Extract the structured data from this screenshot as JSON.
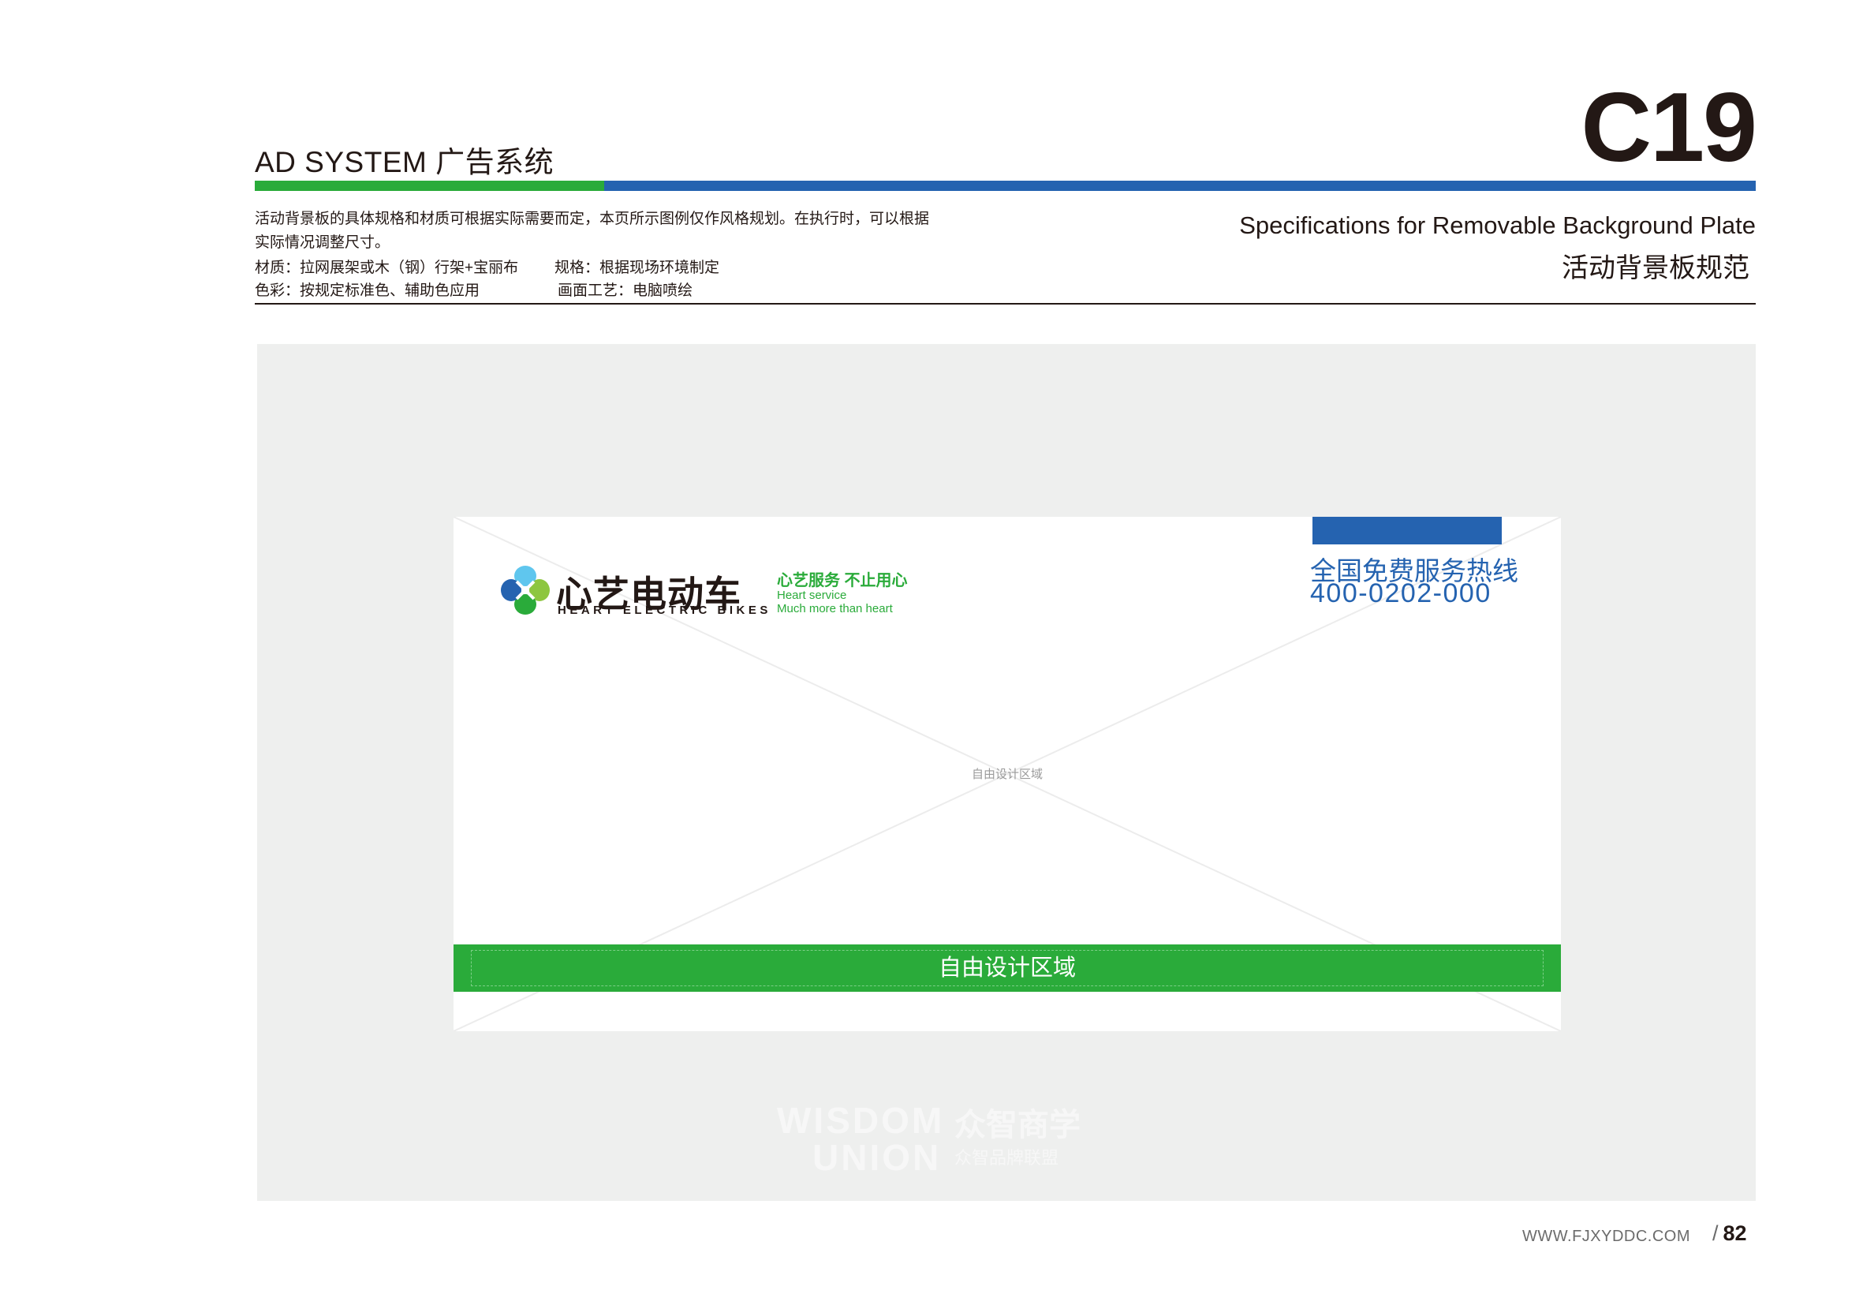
{
  "header": {
    "section_title": "AD SYSTEM 广告系统",
    "page_code": "C19",
    "description": [
      "活动背景板的具体规格和材质可根据实际需要而定，本页所示图例仅作风格规划。在执行时，可以根据",
      "实际情况调整尺寸。",
      "材质：拉网展架或木（钢）行架+宝丽布",
      "规格：根据现场环境制定",
      "色彩：按规定标准色、辅助色应用",
      "画面工艺：电脑喷绘"
    ],
    "spec_title_en": "Specifications for Removable Background Plate",
    "spec_title_zh": "活动背景板规范"
  },
  "plate": {
    "brand_name": "心艺电动车",
    "brand_sub": "HEART ELECTRIC BIKES",
    "slogan_zh": "心艺服务 不止用心",
    "slogan_en_1": "Heart service",
    "slogan_en_2": "Much more than heart",
    "hotline_label": "全国免费服务热线",
    "hotline_number": "400-0202-000",
    "center_label": "自由设计区域",
    "band_label": "自由设计区域"
  },
  "watermark": {
    "line1": "WISDOM",
    "line2": "UNION",
    "zh": "众智商学",
    "zh_sub": "众智品牌联盟"
  },
  "footer": {
    "url": "WWW.FJXYDDC.COM",
    "slash": "/",
    "page": "82"
  },
  "colors": {
    "brand_green": "#2aab3a",
    "brand_blue": "#2563b0",
    "stage_gray": "#eeefee"
  }
}
